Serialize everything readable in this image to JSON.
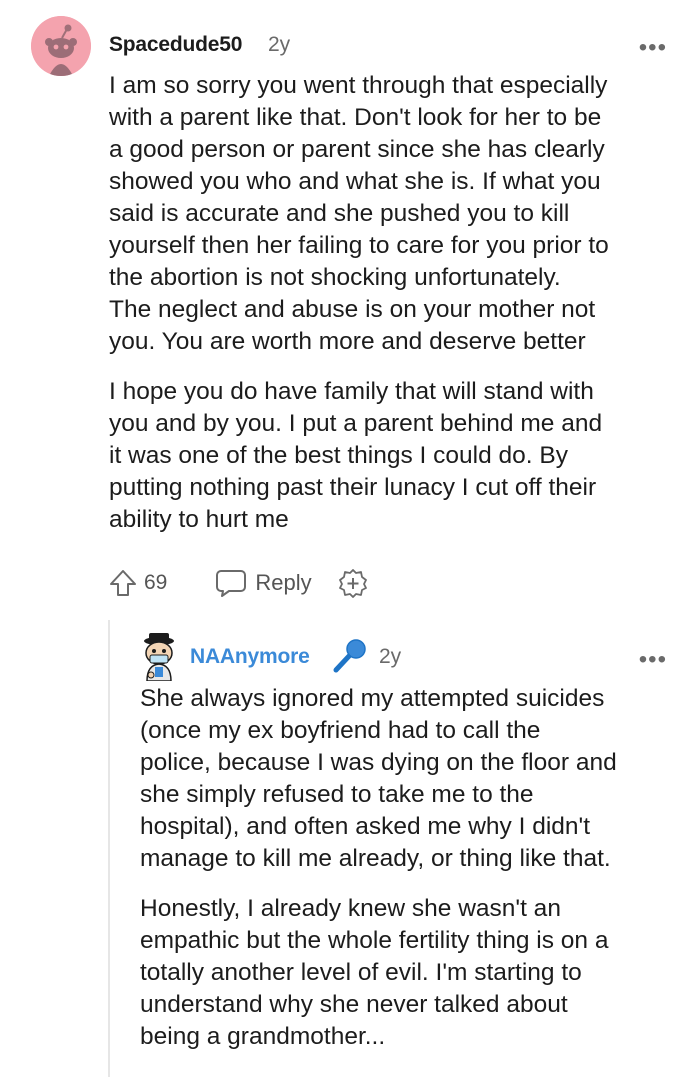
{
  "comment": {
    "username": "Spacedude50",
    "time": "2y",
    "more_label": "•••",
    "paragraphs": [
      "I am so sorry you went through that especially\nwith a parent like that. Don't look for her to be\na good person or parent since she has clearly\nshowed you who and what she is. If what you\nsaid is accurate and she pushed you to kill\nyourself then her failing to care for you prior to\nthe abortion is not shocking unfortunately.\nThe neglect and abuse is on your mother not\nyou. You are worth more and deserve better",
      "I hope you do have family that will stand with\nyou and by you. I put a parent behind me and\nit was one of the best things I could do. By\nputting nothing past their lunacy I cut off their\nability to hurt me"
    ],
    "votes": "69",
    "reply_label": "Reply",
    "icons": {
      "upvote": "upvote-arrow-icon",
      "reply": "speech-bubble-icon",
      "award": "plus-circle-icon",
      "avatar": "snoo-avatar"
    },
    "avatar_color": "#f4a3ae"
  },
  "reply": {
    "username": "NAAnymore",
    "time": "2y",
    "more_label": "•••",
    "username_color": "#3b8ad8",
    "paragraphs": [
      "She always ignored my attempted suicides\n(once my ex boyfriend had to call the\npolice, because I was dying on the floor and\nshe simply refused to take me to the\nhospital), and often asked me why I didn't\nmanage to kill me already, or thing like that.",
      "Honestly, I already knew she wasn't an\nempathic but the whole fertility thing is on a\ntotally another level of evil. I'm starting to\nunderstand why she never talked about\nbeing a grandmother..."
    ],
    "icons": {
      "avatar": "cartoon-avatar",
      "flair": "microphone-icon"
    }
  }
}
